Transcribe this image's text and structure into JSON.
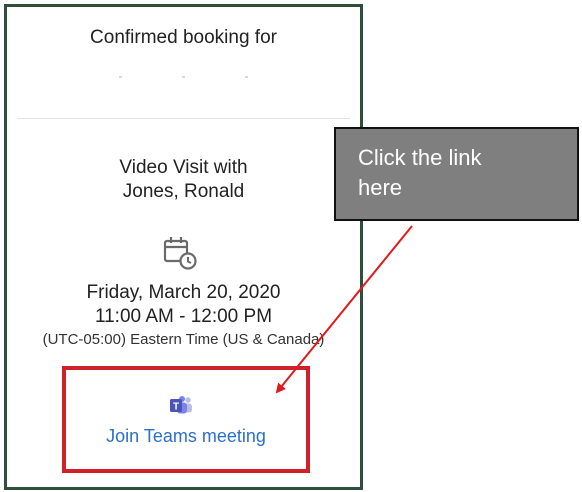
{
  "booking": {
    "heading": "Confirmed booking for",
    "visit_line1": "Video Visit with",
    "visit_line2": "Jones, Ronald",
    "date": "Friday, March 20, 2020",
    "time": "11:00 AM - 12:00 PM",
    "timezone": "(UTC-05:00) Eastern Time (US & Canada)"
  },
  "teams": {
    "icon": "teams-icon",
    "link_label": "Join Teams meeting"
  },
  "callout": {
    "line1": "Click the link",
    "line2": "here"
  },
  "colors": {
    "card_border": "#2f4f3c",
    "highlight_red": "#d0202a",
    "link_blue": "#2b6fce",
    "callout_gray": "#7f7f7f"
  }
}
